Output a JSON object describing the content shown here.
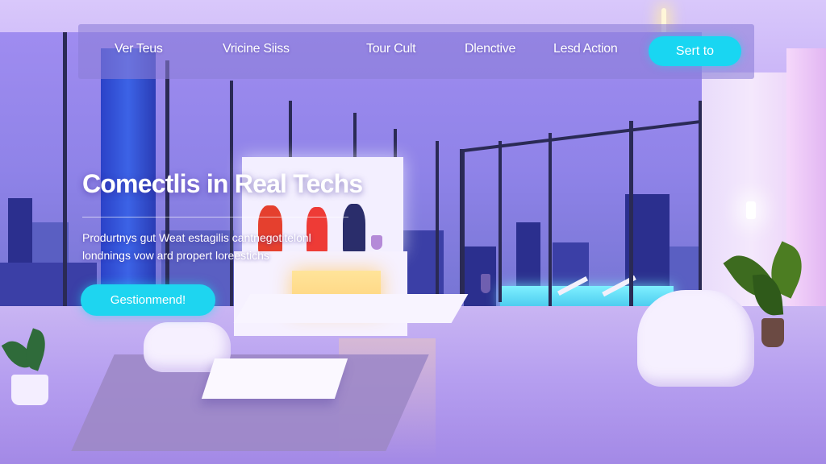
{
  "nav": {
    "links": [
      "Ver Teus",
      "Vricine Siiss",
      "Tour Cult",
      "Dlenctive",
      "Lesd Action"
    ],
    "cta": "Sert to"
  },
  "hero": {
    "title": "Comectlis in Real Techs",
    "subtitle_lines": [
      "Produrtnys gut Weat estagilis cantnegotitelonl",
      "londnings vow ard propert loreestichs"
    ],
    "button": "Gestionmend!"
  },
  "colors": {
    "accent_cyan": "#19d6f2",
    "navbar_bg": "#8c7dd7",
    "scene_purple": "#b9a6f0"
  }
}
